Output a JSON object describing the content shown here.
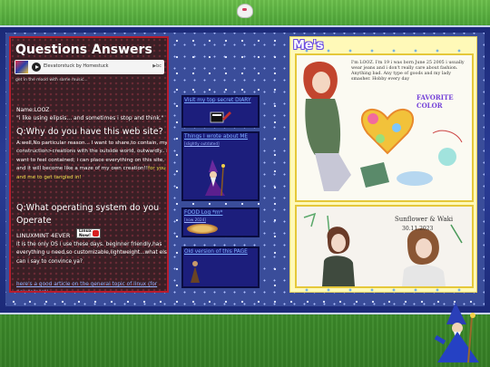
{
  "left": {
    "title": "Questions Answers",
    "player": {
      "track": "Elevatorstuck by Homestuck",
      "brand": "▶bc"
    },
    "mood": "get in the mood with some music...",
    "name": "Name:LOOZ",
    "quote": "\"i like using elipsis... and sometimes i stop and think.\"",
    "q1": "Q:Why do you have this web site?",
    "a1": "A:well,No particular reason... I want to share,to contain, my construction>creations with the outside world, outwardly.. i want to feel contained; i can place everything on this site, and it will become like a maze of my own creation!!",
    "a1_highlight": "for you and me to get tangled in!",
    "q2": "Q:What operating system do you Operate",
    "os": "LINUXMINT 4EVER",
    "linux_badge": "Linux Now!",
    "a2": "it is the only OS i use these days. beginner friendly,has everything u need,so customizable,lightweight...what else can i say to convince ya?",
    "link": "here's a good article on the general topic of linux (for newcomers)."
  },
  "middle": {
    "diary": "Visit my top secret DIARY",
    "things": "Things I wrote about ME",
    "things_sub": "[slightly outdated]",
    "food": "FOOD Log *m*",
    "food_sub": "[now 2024]",
    "old": "Old version of this PAGE"
  },
  "right": {
    "title": "Me's",
    "caption1": "I'm LOOZ. I'm 19 i was born June 25 2005 i usually wear jeans and i don't really care about fashion. Anything bad. Any type of goods and my lady smasher. Hobby every day",
    "favorite": "FAVORITE COLOR",
    "signature": "Sunflower & Waki",
    "date": "30.11.2023"
  }
}
